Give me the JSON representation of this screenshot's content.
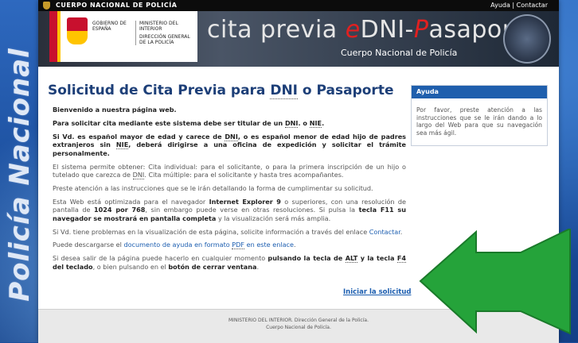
{
  "side_text": "Policía Nacional",
  "topbar": {
    "brand": "CUERPO NACIONAL DE POLICÍA",
    "help": "Ayuda",
    "separator": "|",
    "contact": "Contactar"
  },
  "banner": {
    "gov_ministry": "GOBIERNO DE ESPAÑA",
    "ministry": "MINISTERIO DEL INTERIOR",
    "directorate": "DIRECCIÓN GENERAL DE LA POLICÍA",
    "title_a": "cita previa ",
    "title_e": "e",
    "title_dni": "DNI-",
    "title_p": "P",
    "title_rest": "asaporte",
    "subtitle": "Cuerpo Nacional de Policía"
  },
  "main": {
    "title_pre": "Solicitud de Cita Previa para ",
    "title_dni": "DNI",
    "title_post": " o Pasaporte",
    "p1": "Bienvenido a nuestra página web.",
    "p2_a": "Para solicitar cita mediante este sistema debe ser titular de un ",
    "p2_dni": "DNI",
    "p2_b": ". o ",
    "p2_nie": "NIE",
    "p2_c": ".",
    "p3_a": "Si Vd. es español mayor de edad y carece de ",
    "p3_dni": "DNI",
    "p3_b": ", o es español menor de edad hijo de padres extranjeros sin ",
    "p3_nie": "NIE",
    "p3_c": ", deberá dirigirse a una oficina de expedición y solicitar el trámite personalmente.",
    "p4_a": "El sistema permite obtener: Cita individual: para el solicitante, o para la primera inscripción de un hijo o tutelado que carezca de ",
    "p4_dni": "DNI",
    "p4_b": ". Cita múltiple: para el solicitante y hasta tres acompañantes.",
    "p5": "Preste atención a las instrucciones que se le irán detallando la forma de cumplimentar su solicitud.",
    "p6_a": "Esta Web está optimizada para el navegador ",
    "p6_ie": "Internet Explorer 9",
    "p6_b": " o superiores, con una resolución de pantalla de ",
    "p6_res": "1024 por 768",
    "p6_c": ", sin embargo puede verse en otras resoluciones. Si pulsa la ",
    "p6_f11": "tecla F11 su navegador se mostrará en pantalla completa",
    "p6_d": " y la visualización será más amplia.",
    "p7_a": "Si Vd. tiene problemas en la visualización de esta página, solicite información a través del enlace ",
    "p7_link": "Contactar",
    "p7_b": ".",
    "p8_a": "Puede descargarse el ",
    "p8_link_a": "documento de ayuda en formato ",
    "p8_link_pdf": "PDF",
    "p8_link_b": " en este enlace",
    "p8_b": ".",
    "p9_a": "Si desea salir de la página puede hacerlo en cualquier momento ",
    "p9_b": "pulsando la tecla de ",
    "p9_alt": "ALT",
    "p9_c": " y la tecla ",
    "p9_f4": "F4",
    "p9_d": " del teclado",
    "p9_e": ", o bien pulsando en el ",
    "p9_f": "botón de cerrar ventana",
    "p9_g": ".",
    "start_link": "Iniciar la solicitud"
  },
  "aside": {
    "heading": "Ayuda",
    "body": "Por favor, preste atención a las instrucciones que se le irán dando a lo largo del Web para que su navegación sea más ágil."
  },
  "footer": {
    "line1": "MINISTERIO DEL INTERIOR. Dirección General de la Policía.",
    "line2": "Cuerpo Nacional de Policía."
  },
  "colors": {
    "arrow": "#25a33a",
    "title": "#1d3f78",
    "link": "#1c5eb0",
    "aside_header": "#1f5fad"
  }
}
